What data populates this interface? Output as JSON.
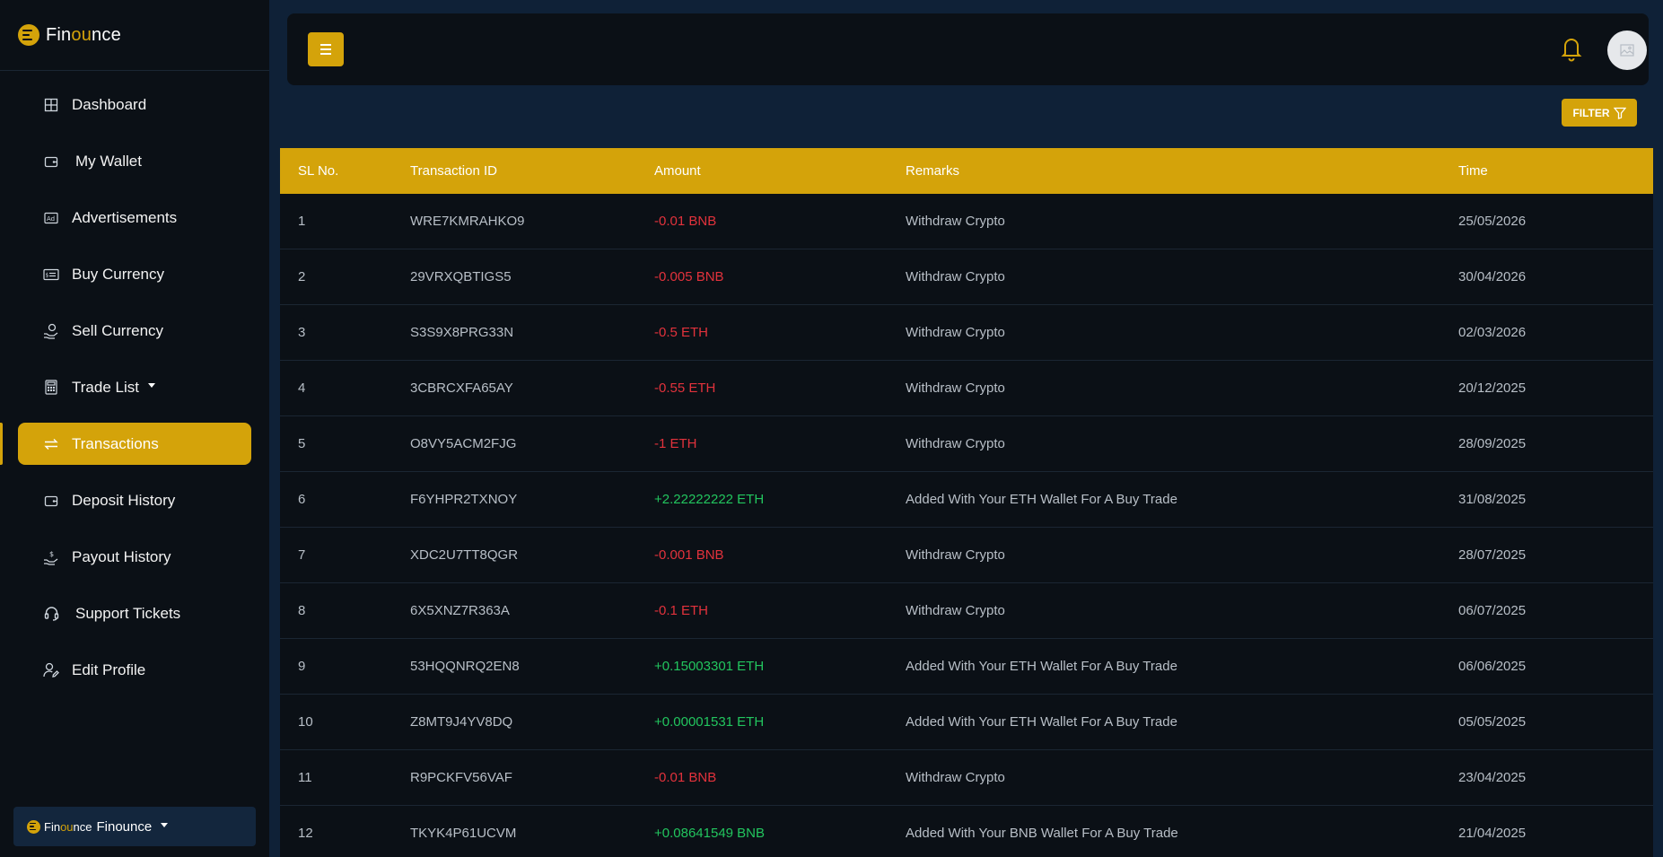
{
  "brand": {
    "prefix": "Fin",
    "highlight": "ou",
    "suffix": "nce"
  },
  "sidebar": {
    "items": [
      {
        "label": "Dashboard",
        "icon": "grid-icon"
      },
      {
        "label": "My Wallet",
        "icon": "wallet-icon"
      },
      {
        "label": "Advertisements",
        "icon": "ad-icon"
      },
      {
        "label": "Buy Currency",
        "icon": "card-icon"
      },
      {
        "label": "Sell Currency",
        "icon": "hand-coin-icon"
      },
      {
        "label": "Trade List",
        "icon": "calculator-icon"
      },
      {
        "label": "Transactions",
        "icon": "transfer-icon"
      },
      {
        "label": "Deposit History",
        "icon": "wallet-icon"
      },
      {
        "label": "Payout History",
        "icon": "payout-icon"
      },
      {
        "label": "Support Tickets",
        "icon": "headset-icon"
      },
      {
        "label": "Edit Profile",
        "icon": "user-edit-icon"
      }
    ],
    "active": "Transactions"
  },
  "user_switch": {
    "name": "Finounce"
  },
  "filter_label": "FILTER",
  "colors": {
    "accent": "#d4a30a",
    "negative": "#e2323c",
    "positive": "#22c55e",
    "surface": "#0b1016",
    "background": "#0f2137"
  },
  "table": {
    "headers": [
      "SL No.",
      "Transaction ID",
      "Amount",
      "Remarks",
      "Time"
    ],
    "rows": [
      {
        "sl": "1",
        "id": "WRE7KMRAHKO9",
        "amount": "-0.01 BNB",
        "sign": "neg",
        "remarks": "Withdraw Crypto",
        "time": "25/05/2026"
      },
      {
        "sl": "2",
        "id": "29VRXQBTIGS5",
        "amount": "-0.005 BNB",
        "sign": "neg",
        "remarks": "Withdraw Crypto",
        "time": "30/04/2026"
      },
      {
        "sl": "3",
        "id": "S3S9X8PRG33N",
        "amount": "-0.5 ETH",
        "sign": "neg",
        "remarks": "Withdraw Crypto",
        "time": "02/03/2026"
      },
      {
        "sl": "4",
        "id": "3CBRCXFA65AY",
        "amount": "-0.55 ETH",
        "sign": "neg",
        "remarks": "Withdraw Crypto",
        "time": "20/12/2025"
      },
      {
        "sl": "5",
        "id": "O8VY5ACM2FJG",
        "amount": "-1 ETH",
        "sign": "neg",
        "remarks": "Withdraw Crypto",
        "time": "28/09/2025"
      },
      {
        "sl": "6",
        "id": "F6YHPR2TXNOY",
        "amount": "+2.22222222 ETH",
        "sign": "pos",
        "remarks": "Added With Your ETH Wallet For A Buy Trade",
        "time": "31/08/2025"
      },
      {
        "sl": "7",
        "id": "XDC2U7TT8QGR",
        "amount": "-0.001 BNB",
        "sign": "neg",
        "remarks": "Withdraw Crypto",
        "time": "28/07/2025"
      },
      {
        "sl": "8",
        "id": "6X5XNZ7R363A",
        "amount": "-0.1 ETH",
        "sign": "neg",
        "remarks": "Withdraw Crypto",
        "time": "06/07/2025"
      },
      {
        "sl": "9",
        "id": "53HQQNRQ2EN8",
        "amount": "+0.15003301 ETH",
        "sign": "pos",
        "remarks": "Added With Your ETH Wallet For A Buy Trade",
        "time": "06/06/2025"
      },
      {
        "sl": "10",
        "id": "Z8MT9J4YV8DQ",
        "amount": "+0.00001531 ETH",
        "sign": "pos",
        "remarks": "Added With Your ETH Wallet For A Buy Trade",
        "time": "05/05/2025"
      },
      {
        "sl": "11",
        "id": "R9PCKFV56VAF",
        "amount": "-0.01 BNB",
        "sign": "neg",
        "remarks": "Withdraw Crypto",
        "time": "23/04/2025"
      },
      {
        "sl": "12",
        "id": "TKYK4P61UCVM",
        "amount": "+0.08641549 BNB",
        "sign": "pos",
        "remarks": "Added With Your BNB Wallet For A Buy Trade",
        "time": "21/04/2025"
      }
    ]
  }
}
